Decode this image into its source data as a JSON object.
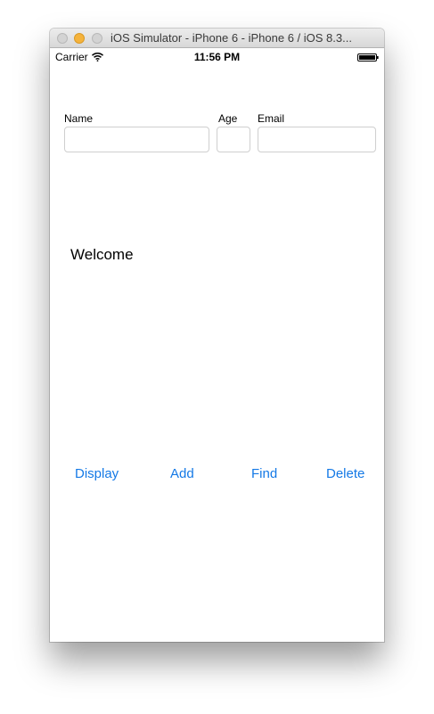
{
  "window": {
    "title": "iOS Simulator - iPhone 6 - iPhone 6 / iOS 8.3..."
  },
  "statusbar": {
    "carrier": "Carrier",
    "time": "11:56 PM",
    "icons": [
      "wifi-icon",
      "battery-icon"
    ]
  },
  "form": {
    "name_label": "Name",
    "name_value": "",
    "age_label": "Age",
    "age_value": "",
    "email_label": "Email",
    "email_value": ""
  },
  "message": "Welcome",
  "actions": {
    "display": "Display",
    "add": "Add",
    "find": "Find",
    "delete": "Delete"
  },
  "colors": {
    "accent": "#1479e6",
    "minimize_button": "#f5b33c"
  }
}
